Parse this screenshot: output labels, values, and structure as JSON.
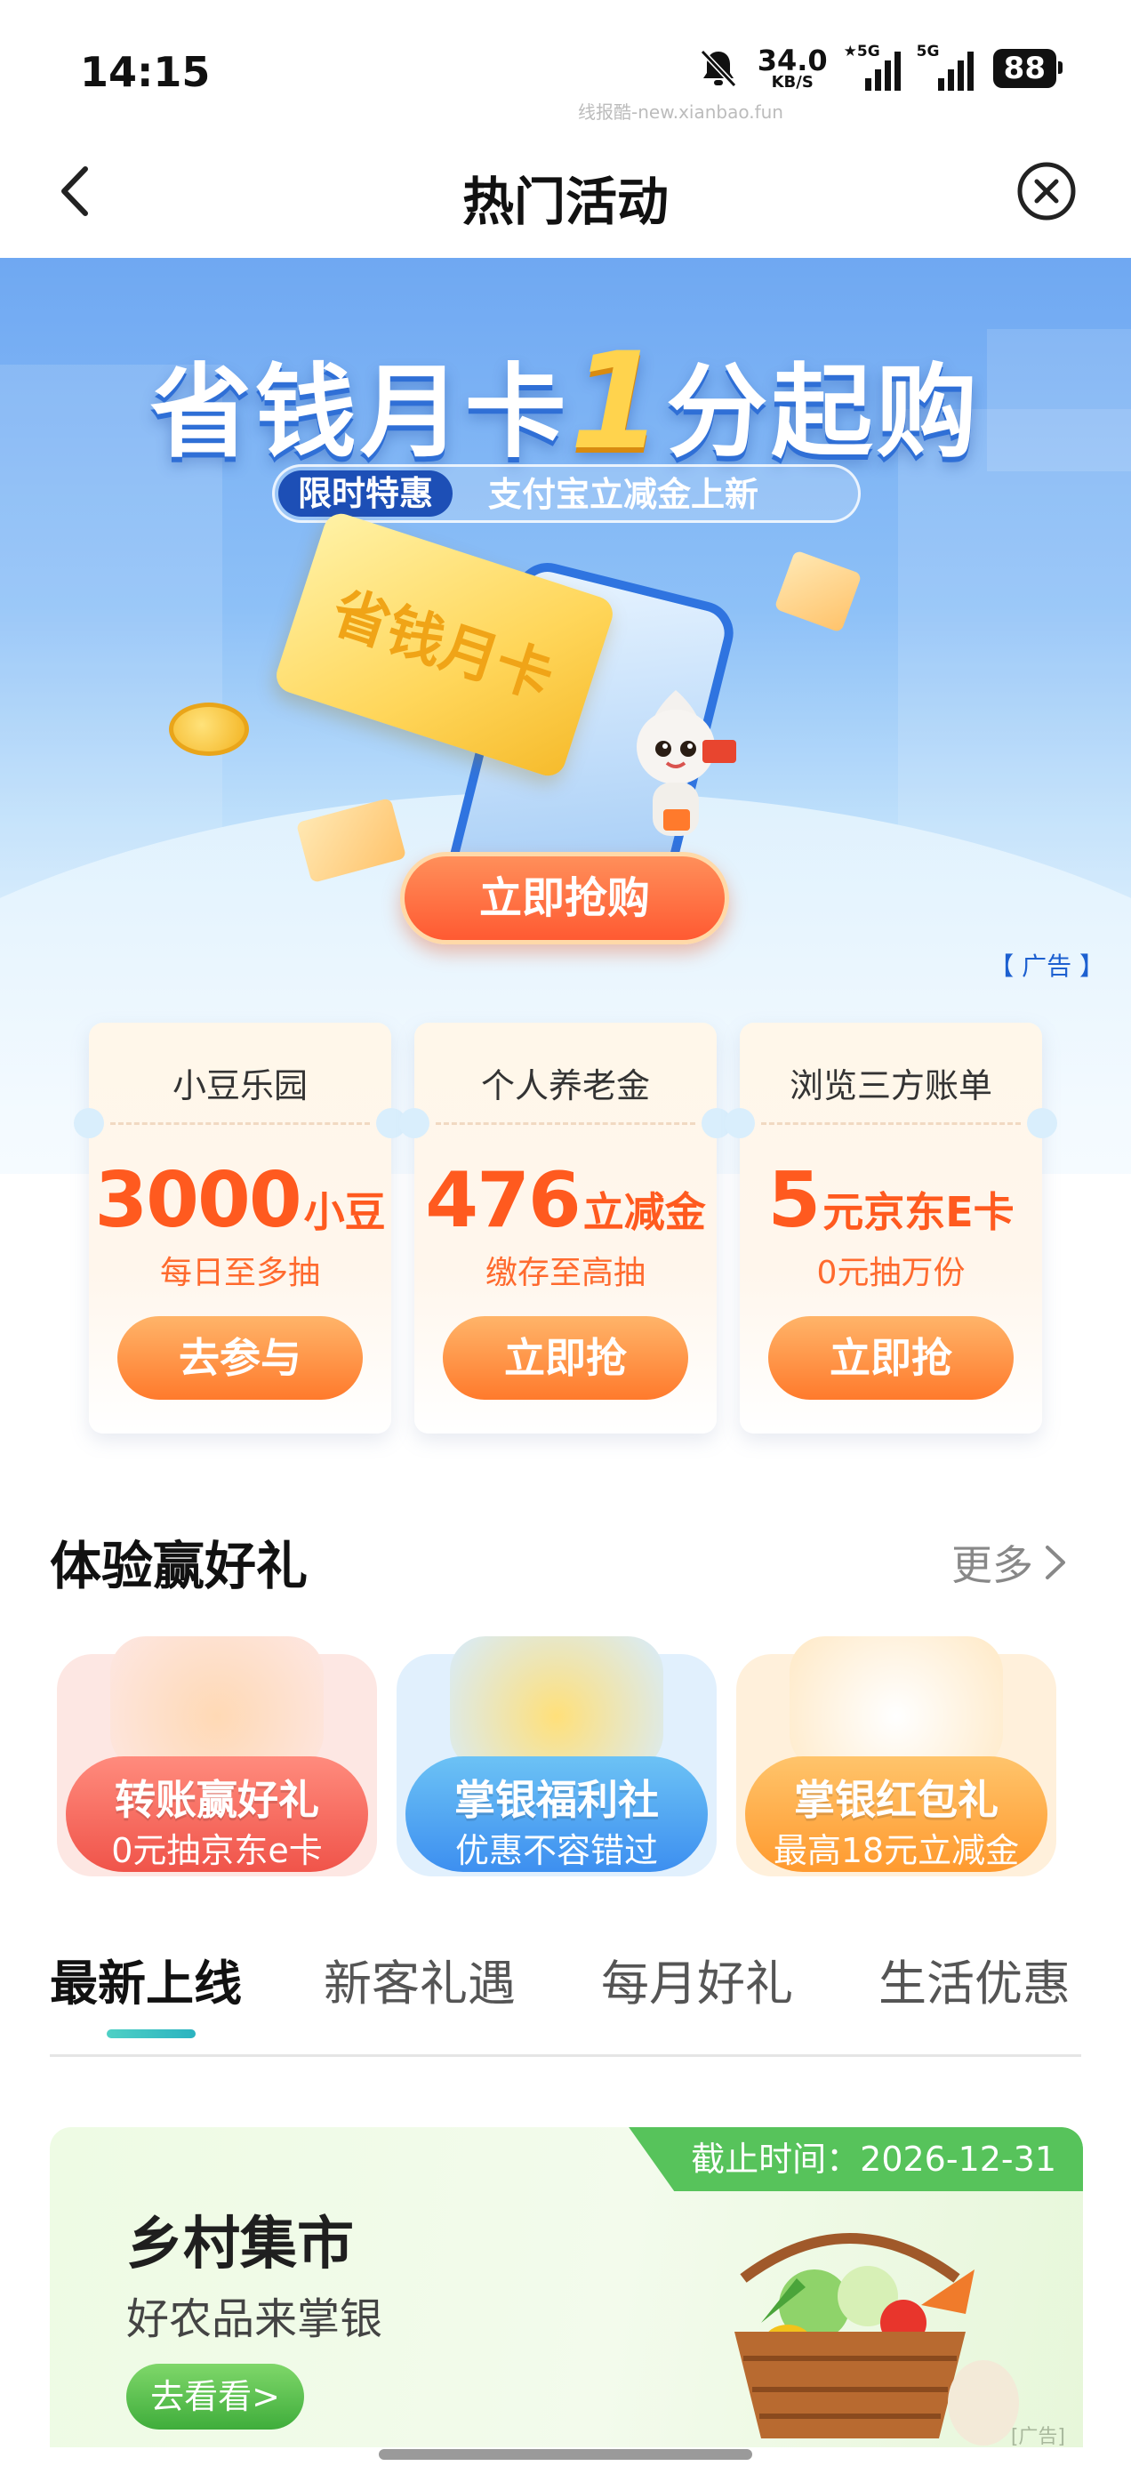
{
  "status_bar": {
    "time": "14:15",
    "net_speed": "34.0",
    "net_unit": "KB/S",
    "sig1_tag": "★5G",
    "sig2_tag": "5G",
    "battery": "88",
    "watermark": "线报酷-new.xianbao.fun"
  },
  "nav": {
    "title": "热门活动",
    "back_icon": "chevron-left-icon",
    "close_icon": "close-circle-icon"
  },
  "banner": {
    "headline_a": "省钱月卡",
    "headline_num": "1",
    "headline_b": "分起购",
    "pill": "限时特惠",
    "subtitle": "支付宝立减金上新",
    "card_text": "省钱月卡",
    "cta": "立即抢购",
    "ad_tag": "【 广告 】"
  },
  "promos": [
    {
      "title": "小豆乐园",
      "big": "3000",
      "unit": "小豆",
      "desc": "每日至多抽",
      "button": "去参与"
    },
    {
      "title": "个人养老金",
      "big": "476",
      "unit": "立减金",
      "desc": "缴存至高抽",
      "button": "立即抢"
    },
    {
      "title": "浏览三方账单",
      "big": "5",
      "unit": "元京东E卡",
      "desc": "0元抽万份",
      "button": "立即抢"
    }
  ],
  "experience": {
    "title": "体验赢好礼",
    "more": "更多",
    "items": [
      {
        "l1": "转账赢好礼",
        "l2": "0元抽京东e卡"
      },
      {
        "l1": "掌银福利社",
        "l2": "优惠不容错过"
      },
      {
        "l1": "掌银红包礼",
        "l2": "最高18元立减金"
      }
    ]
  },
  "tabs": [
    "最新上线",
    "新客礼遇",
    "每月好礼",
    "生活优惠"
  ],
  "activity": {
    "deadline": "截止时间：2026-12-31",
    "title": "乡村集市",
    "subtitle": "好农品来掌银",
    "button": "去看看>",
    "ad_tag": "[广告]"
  },
  "colors": {
    "accent_orange": "#ff5a1f",
    "brand_blue": "#1d4fb6",
    "green": "#57c35b"
  }
}
